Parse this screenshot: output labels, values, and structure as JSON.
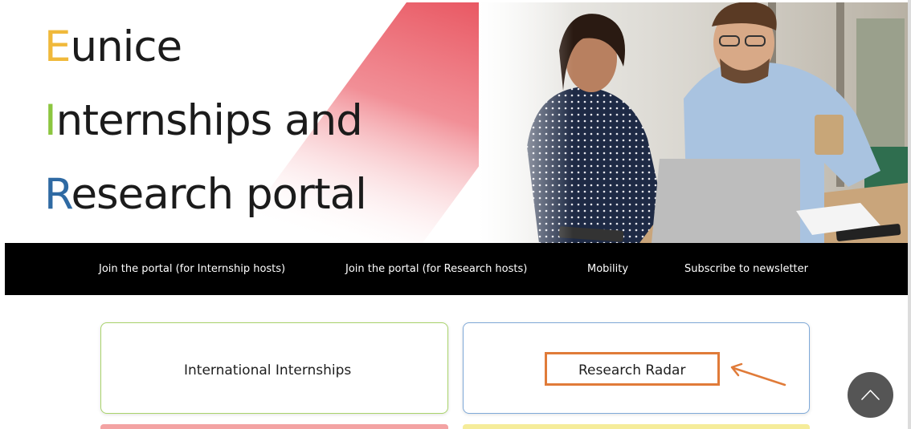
{
  "hero": {
    "title_lines": [
      {
        "initial": "E",
        "rest": "unice",
        "initial_color": "#f0b93b"
      },
      {
        "initial": "I",
        "rest": "nternships and",
        "initial_color": "#8cc63f"
      },
      {
        "initial": "R",
        "rest": "esearch portal",
        "initial_color": "#2f6aa3"
      }
    ],
    "photo_icon": "people-at-laptop-photo"
  },
  "nav": {
    "items": [
      {
        "label": "Join the portal (for Internship hosts)"
      },
      {
        "label": "Join the portal (for Research hosts)"
      },
      {
        "label": "Mobility"
      },
      {
        "label": "Subscribe to newsletter"
      }
    ],
    "background": "#000000"
  },
  "cards": [
    {
      "label": "International Internships",
      "border_color": "#a9d36b"
    },
    {
      "label": "Research Radar",
      "border_color": "#7fa9d8"
    }
  ],
  "annotation": {
    "highlight_color": "#e07b39"
  },
  "scroll_top": {
    "icon": "chevron-up-icon"
  },
  "colors": {
    "stripe_red": "#e8545f",
    "card_strip_red": "#f08a8a",
    "card_strip_yellow": "#f5e98a"
  }
}
